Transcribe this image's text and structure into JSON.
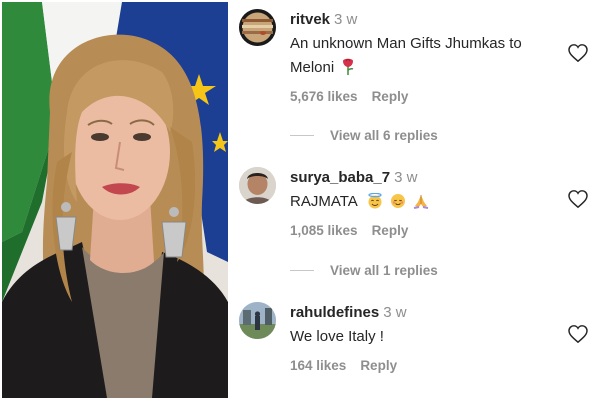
{
  "photo": {
    "description_icon": "portrait-photo"
  },
  "comments": [
    {
      "username": "ritvek",
      "time": "3 w",
      "text_line1": "An unknown Man Gifts Jhumkas to",
      "text_line2": "Meloni",
      "emoji": [
        "rose-icon"
      ],
      "likes": "5,676 likes",
      "reply": "Reply",
      "view_replies": "View all 6 replies"
    },
    {
      "username": "surya_baba_7",
      "time": "3 w",
      "text_line1": "RAJMATA",
      "emoji": [
        "halo-face-icon",
        "relieved-face-icon",
        "folded-hands-icon"
      ],
      "likes": "1,085 likes",
      "reply": "Reply",
      "view_replies": "View all 1 replies"
    },
    {
      "username": "rahuldefines",
      "time": "3 w",
      "text_line1": "We love Italy !",
      "likes": "164 likes",
      "reply": "Reply"
    }
  ],
  "colors": {
    "text": "#262626",
    "muted": "#8e8e8e",
    "rose": "#d6304a"
  }
}
